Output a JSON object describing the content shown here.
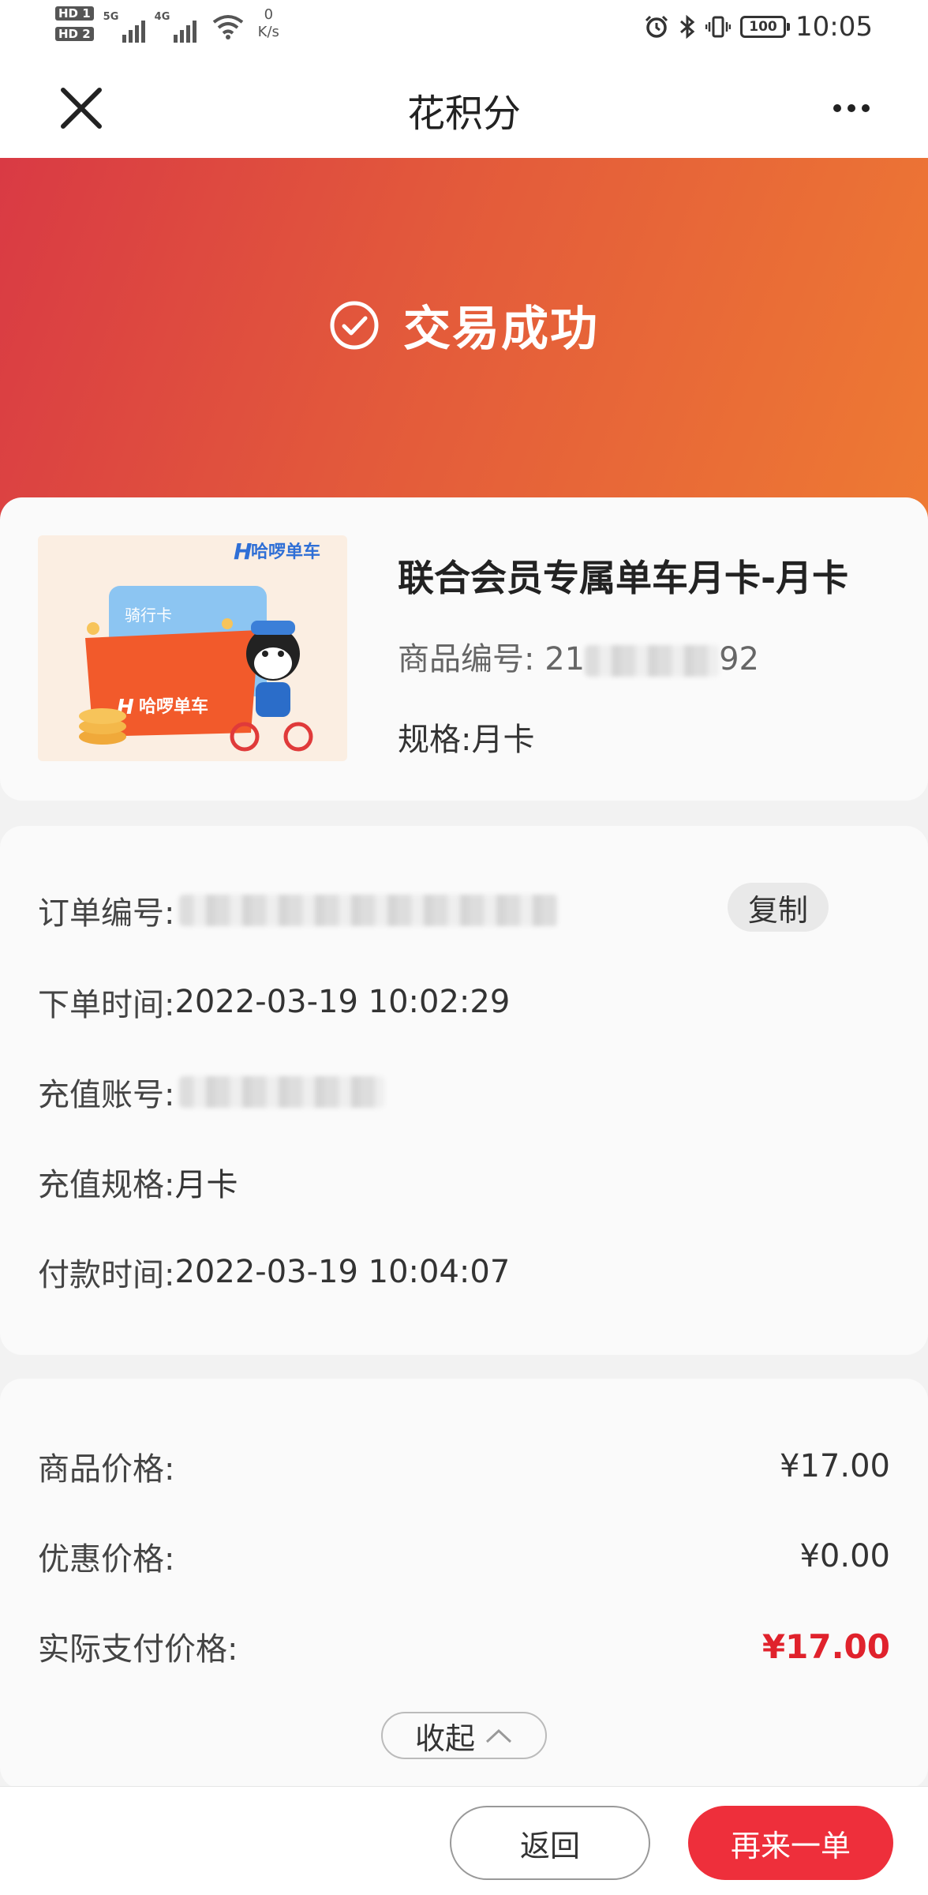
{
  "status_bar": {
    "sim1": "HD 1",
    "sim2": "HD 2",
    "gen1": "5G",
    "gen2": "4G",
    "speed_value": "0",
    "speed_unit": "K/s",
    "battery": "100",
    "time": "10:05"
  },
  "header": {
    "title": "花积分"
  },
  "banner": {
    "status_text": "交易成功",
    "accent": "#e35a3b"
  },
  "product": {
    "brand": "哈啰单车",
    "card_label": "骑行卡",
    "title": "联合会员专属单车月卡-月卡",
    "code_label": "商品编号:",
    "code_visible_start": "21",
    "code_visible_end": "92",
    "spec_label": "规格:",
    "spec_value": "月卡"
  },
  "order": {
    "order_no_label": "订单编号:",
    "copy_label": "复制",
    "order_time_label": "下单时间:",
    "order_time_value": "2022-03-19 10:02:29",
    "account_label": "充值账号:",
    "spec_label": "充值规格:",
    "spec_value": "月卡",
    "pay_time_label": "付款时间:",
    "pay_time_value": "2022-03-19 10:04:07"
  },
  "price": {
    "goods_price_label": "商品价格:",
    "goods_price_value": "¥17.00",
    "discount_label": "优惠价格:",
    "discount_value": "¥0.00",
    "paid_label": "实际支付价格:",
    "paid_value": "¥17.00",
    "paid_color": "#e0222c",
    "collapse_label": "收起"
  },
  "bottom": {
    "back_label": "返回",
    "again_label": "再来一单",
    "again_color": "#ee2f3b"
  }
}
